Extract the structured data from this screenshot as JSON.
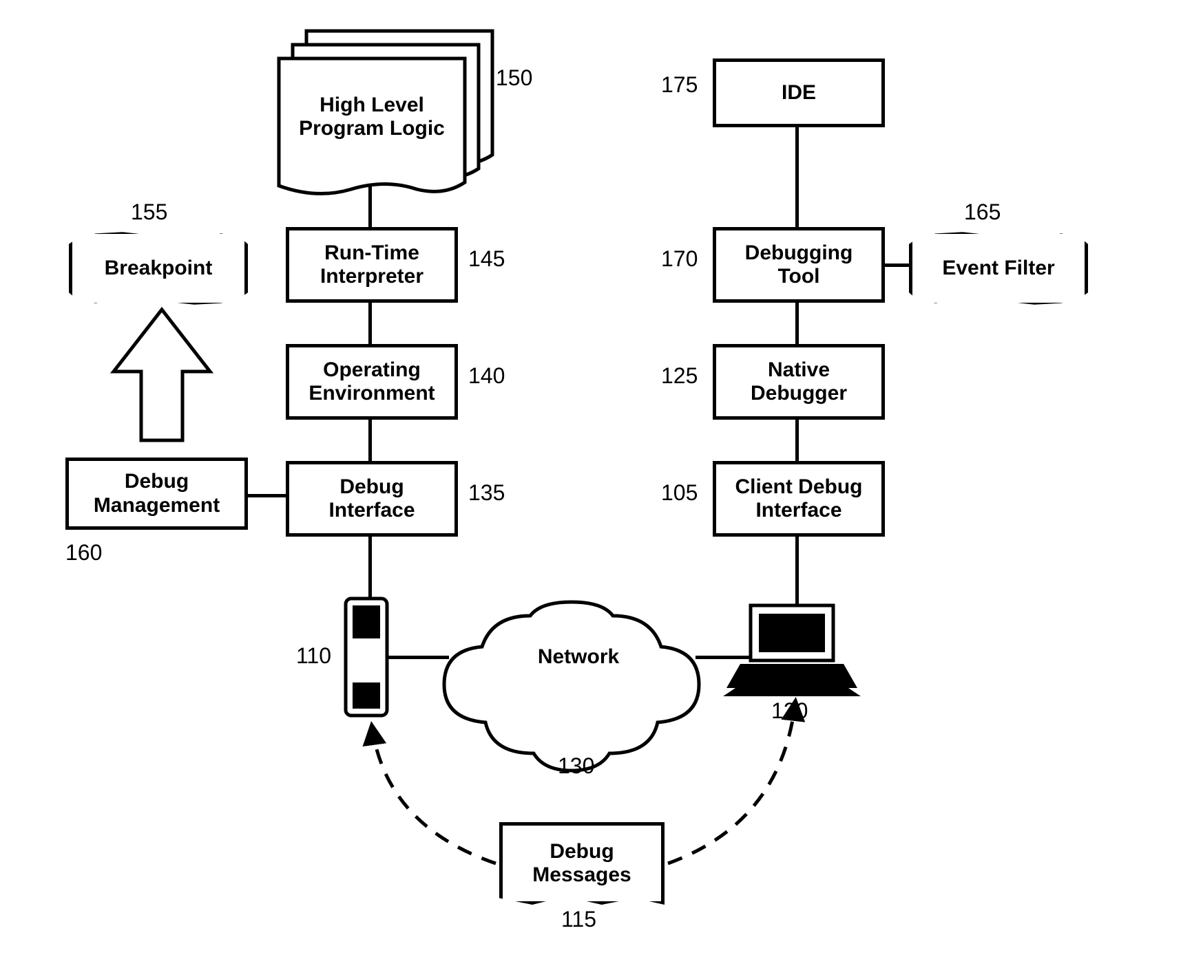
{
  "nodes": {
    "high_level_program_logic": {
      "label": "High Level\nProgram Logic",
      "ref": "150"
    },
    "run_time_interpreter": {
      "label": "Run-Time\nInterpreter",
      "ref": "145"
    },
    "operating_environment": {
      "label": "Operating\nEnvironment",
      "ref": "140"
    },
    "debug_interface": {
      "label": "Debug\nInterface",
      "ref": "135"
    },
    "debug_management": {
      "label": "Debug\nManagement",
      "ref": "160"
    },
    "breakpoint": {
      "label": "Breakpoint",
      "ref": "155"
    },
    "ide": {
      "label": "IDE",
      "ref": "175"
    },
    "debugging_tool": {
      "label": "Debugging\nTool",
      "ref": "170"
    },
    "native_debugger": {
      "label": "Native\nDebugger",
      "ref": "125"
    },
    "client_debug_interface": {
      "label": "Client Debug\nInterface",
      "ref": "105"
    },
    "event_filter": {
      "label": "Event Filter",
      "ref": "165"
    },
    "network": {
      "label": "Network",
      "ref": "130"
    },
    "phone": {
      "label": "",
      "ref": "110"
    },
    "laptop": {
      "label": "",
      "ref": "120"
    },
    "debug_messages": {
      "label": "Debug\nMessages",
      "ref": "115"
    }
  }
}
